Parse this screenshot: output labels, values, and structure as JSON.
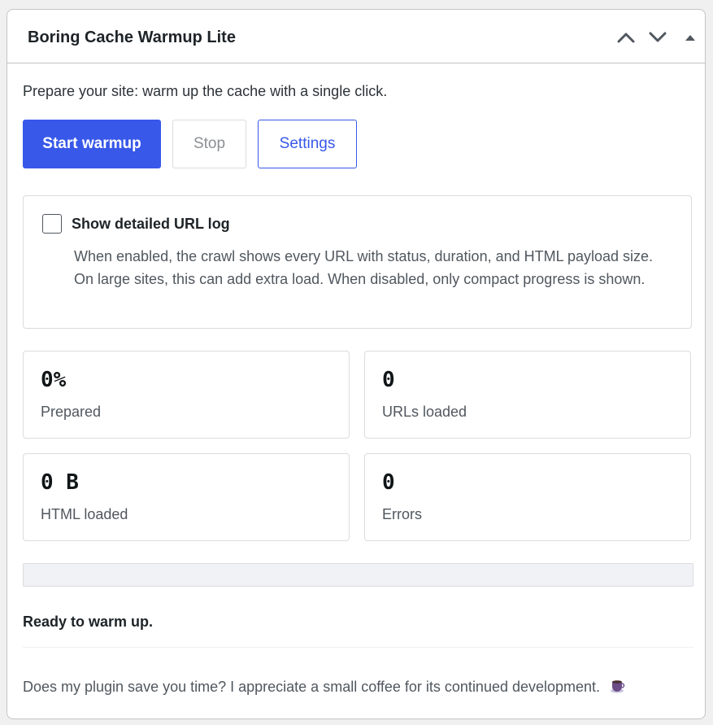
{
  "widget": {
    "title": "Boring Cache Warmup Lite",
    "intro": "Prepare your site: warm up the cache with a single click.",
    "buttons": {
      "start": "Start warmup",
      "stop": "Stop",
      "settings": "Settings"
    },
    "log": {
      "label": "Show detailed URL log",
      "checked": false,
      "description": "When enabled, the crawl shows every URL with status, duration, and HTML payload size. On large sites, this can add extra load. When disabled, only compact progress is shown."
    },
    "stats": [
      {
        "value": "0%",
        "label": "Prepared"
      },
      {
        "value": "0",
        "label": "URLs loaded"
      },
      {
        "value": "0 B",
        "label": "HTML loaded"
      },
      {
        "value": "0",
        "label": "Errors"
      }
    ],
    "progress_percent": 0,
    "status": "Ready to warm up.",
    "footer": "Does my plugin save you time? I appreciate a small coffee for its continued development."
  },
  "header_icons": [
    "chevron-up-icon",
    "chevron-down-icon",
    "caret-up-icon"
  ],
  "footer_icon": "coffee-icon",
  "colors": {
    "primary": "#3858e9",
    "border": "#dcdcde",
    "text": "#1d2327",
    "muted": "#50575e"
  }
}
